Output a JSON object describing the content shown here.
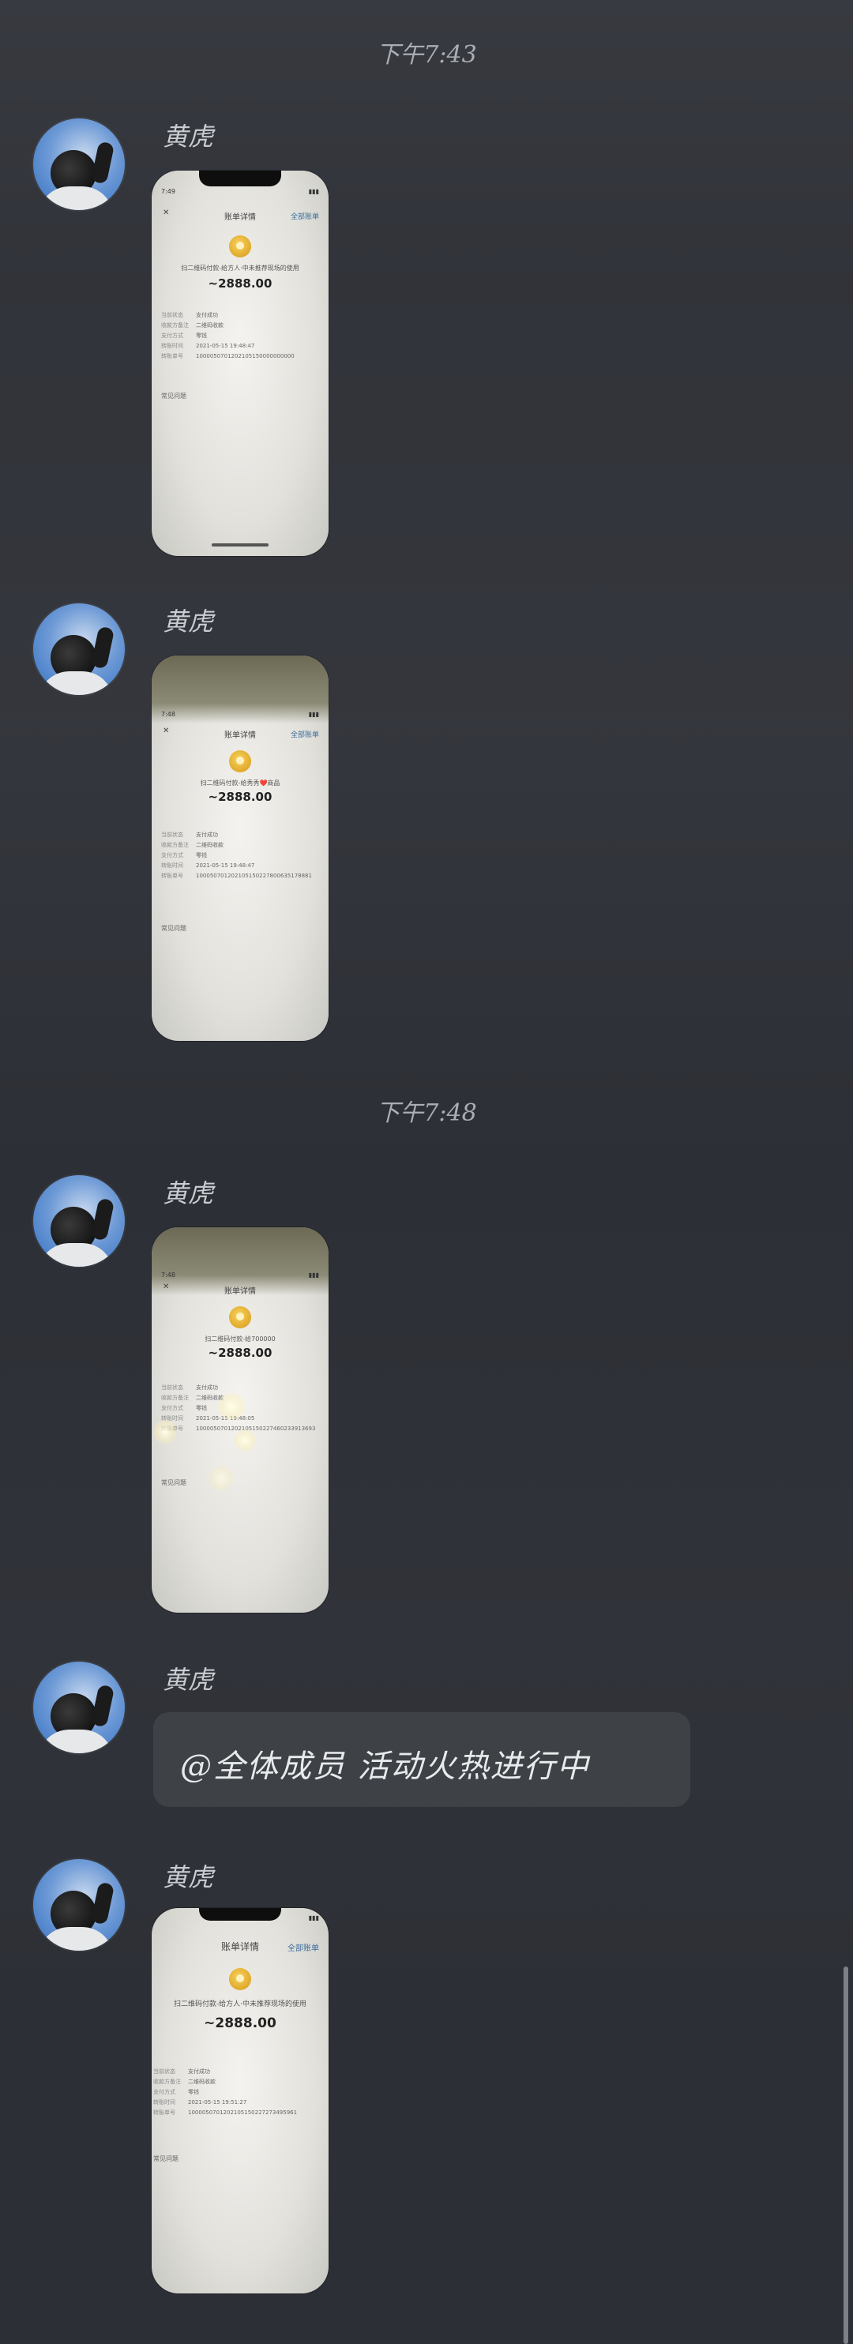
{
  "timestamps": [
    "下午7:43",
    "下午7:48"
  ],
  "sender_name": "黄虎",
  "text_message": "@全体成员 活动火热进行中",
  "photo_messages": [
    {
      "status_time": "7:49",
      "nav_title": "账单详情",
      "nav_right": "全部账单",
      "description": "扫二维码付款-给方人·中未推荐现场的使用",
      "amount": "~2888.00",
      "rows": [
        {
          "key": "当前状态",
          "value": "支付成功"
        },
        {
          "key": "收款方备注",
          "value": "二维码收款"
        },
        {
          "key": "支付方式",
          "value": "零钱"
        },
        {
          "key": "转账时间",
          "value": "2021-05-15 19:48:47"
        },
        {
          "key": "转账单号",
          "value": "1000050701202105150000000000"
        }
      ],
      "link": "常见问题"
    },
    {
      "status_time": "7:48",
      "nav_title": "账单详情",
      "nav_right": "全部账单",
      "description": "扫二维码付款-给秀秀❤️商品",
      "amount": "~2888.00",
      "rows": [
        {
          "key": "当前状态",
          "value": "支付成功"
        },
        {
          "key": "收款方备注",
          "value": "二维码收款"
        },
        {
          "key": "支付方式",
          "value": "零钱"
        },
        {
          "key": "转账时间",
          "value": "2021-05-15 19:48:47"
        },
        {
          "key": "转账单号",
          "value": "100050701202105150227800635178881"
        }
      ],
      "link": "常见问题"
    },
    {
      "status_time": "7:48",
      "nav_title": "账单详情",
      "nav_right": "全部账单",
      "description": "扫二维码付款-给700000",
      "amount": "~2888.00",
      "rows": [
        {
          "key": "当前状态",
          "value": "支付成功"
        },
        {
          "key": "收款方备注",
          "value": "二维码收款"
        },
        {
          "key": "支付方式",
          "value": "零钱"
        },
        {
          "key": "转账时间",
          "value": "2021-05-15 19:48:05"
        },
        {
          "key": "转账单号",
          "value": "1000050701202105150227460233913693"
        }
      ],
      "link": "常见问题"
    },
    {
      "status_time": "",
      "nav_title": "账单详情",
      "nav_right": "全部账单",
      "description": "扫二维码付款-给方人·中未推荐现场的使用",
      "amount": "~2888.00",
      "rows": [
        {
          "key": "当前状态",
          "value": "支付成功"
        },
        {
          "key": "收款方备注",
          "value": "二维码收款"
        },
        {
          "key": "支付方式",
          "value": "零钱"
        },
        {
          "key": "转账时间",
          "value": "2021-05-15 19:51:27"
        },
        {
          "key": "转账单号",
          "value": "1000050701202105150227273495961"
        }
      ],
      "link": "常见问题"
    }
  ]
}
